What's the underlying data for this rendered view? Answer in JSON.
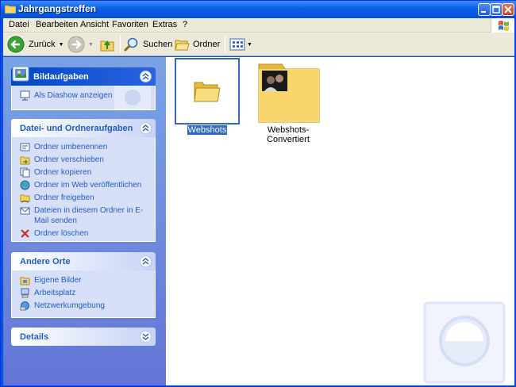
{
  "window": {
    "title": "Jahrgangstreffen"
  },
  "menu": [
    "Datei",
    "Bearbeiten",
    "Ansicht",
    "Favoriten",
    "Extras",
    "?"
  ],
  "toolbar": {
    "back_label": "Zurück",
    "search_label": "Suchen",
    "folders_label": "Ordner"
  },
  "taskpane": {
    "picture_tasks": {
      "title": "Bildaufgaben",
      "items": [
        "Als Diashow anzeigen"
      ]
    },
    "file_tasks": {
      "title": "Datei- und Ordneraufgaben",
      "items": [
        "Ordner umbenennen",
        "Ordner verschieben",
        "Ordner kopieren",
        "Ordner im Web veröffentlichen",
        "Ordner freigeben",
        "Dateien in diesem Ordner in E-Mail senden",
        "Ordner löschen"
      ]
    },
    "other_places": {
      "title": "Andere Orte",
      "items": [
        "Eigene Bilder",
        "Arbeitsplatz",
        "Netzwerkumgebung"
      ]
    },
    "details": {
      "title": "Details"
    }
  },
  "content": {
    "folders": [
      {
        "name": "Webshots",
        "selected": true
      },
      {
        "name": "Webshots-Convertiert",
        "selected": false
      }
    ]
  },
  "colors": {
    "title_blue": "#0054e3",
    "task_link": "#215dc6",
    "selection": "#316ac5",
    "folder_yellow": "#f6d46a"
  }
}
